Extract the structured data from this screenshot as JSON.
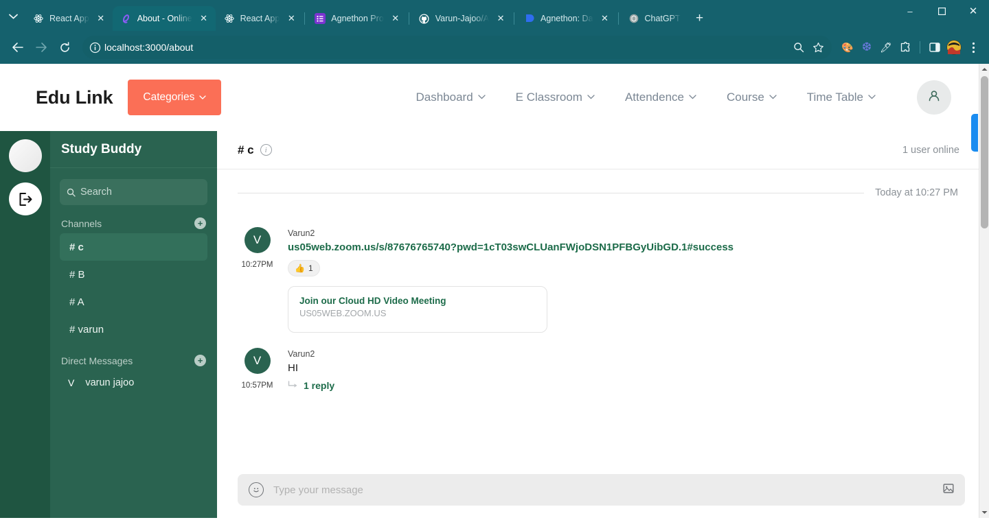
{
  "browser": {
    "tab_list_icon": "chevron-down-icon",
    "tabs": [
      {
        "title": "React App",
        "favicon": "react-icon",
        "active": false
      },
      {
        "title": "About - Online",
        "favicon": "swirl-icon",
        "active": true
      },
      {
        "title": "React App",
        "favicon": "react-icon",
        "active": false
      },
      {
        "title": "Agnethon Pro",
        "favicon": "list-icon",
        "active": false
      },
      {
        "title": "Varun-Jajoo/A",
        "favicon": "github-icon",
        "active": false
      },
      {
        "title": "Agnethon: Da",
        "favicon": "blue-doc-icon",
        "active": false
      },
      {
        "title": "ChatGPT",
        "favicon": "chatgpt-icon",
        "active": false
      }
    ],
    "new_tab_label": "+",
    "window_controls": {
      "minimize": "–",
      "maximize": "☐",
      "close": "✕"
    },
    "toolbar": {
      "back_label": "←",
      "forward_label": "→",
      "reload_label": "↻",
      "site_info_icon": "info-circle-icon",
      "url": "localhost:3000/about",
      "url_host": "localhost",
      "url_path": ":3000/about",
      "search_icon": "search-icon",
      "bookmark_icon": "star-icon",
      "extensions": [
        {
          "name": "color-palette-extension",
          "glyph": "🎨"
        },
        {
          "name": "snowflake-extension",
          "glyph": "❆"
        },
        {
          "name": "eyedropper-extension",
          "glyph": "🖊"
        },
        {
          "name": "puzzle-extensions",
          "glyph": "⬚"
        }
      ],
      "side_panel_icon": "side-panel-icon",
      "profile_icon": "profile-avatar-icon",
      "menu_icon": "three-dot-menu-icon"
    }
  },
  "site_header": {
    "brand": "Edu Link",
    "categories_label": "Categories",
    "caret": "˅",
    "nav": [
      {
        "label": "Dashboard"
      },
      {
        "label": "E Classroom"
      },
      {
        "label": "Attendence"
      },
      {
        "label": "Course"
      },
      {
        "label": "Time Table"
      }
    ],
    "profile_icon": "person-icon"
  },
  "rail": {
    "workspace_icon": "workspace-avatar",
    "logout_icon": "logout-icon"
  },
  "sidebar": {
    "title": "Study Buddy",
    "search": {
      "icon": "search-icon",
      "placeholder": "Search",
      "value": ""
    },
    "channels_section": {
      "label": "Channels",
      "add_label": "+"
    },
    "channels": [
      {
        "label": "# c",
        "active": true
      },
      {
        "label": "# B",
        "active": false
      },
      {
        "label": "# A",
        "active": false
      },
      {
        "label": "# varun",
        "active": false
      }
    ],
    "dm_section": {
      "label": "Direct Messages",
      "add_label": "+"
    },
    "direct_messages": [
      {
        "initial": "V",
        "name": "varun jajoo"
      }
    ]
  },
  "chat": {
    "channel": "# c",
    "info_icon": "info-circle-icon",
    "users_online": "1 user online",
    "date_divider": "Today at 10:27 PM",
    "messages": [
      {
        "author": "Varun2",
        "avatar_initial": "V",
        "time": "10:27PM",
        "text": "us05web.zoom.us/s/87676765740?pwd=1cT03swCLUanFWjoDSN1PFBGyUibGD.1#success",
        "is_link": true,
        "reaction": {
          "emoji": "👍",
          "count": "1"
        },
        "link_card": {
          "title": "Join our Cloud HD Video Meeting",
          "host": "US05WEB.ZOOM.US"
        }
      },
      {
        "author": "Varun2",
        "avatar_initial": "V",
        "time": "10:57PM",
        "text": "HI",
        "is_link": false,
        "thread": {
          "label": "1 reply",
          "arrow_icon": "reply-arrow-icon"
        }
      }
    ],
    "composer": {
      "emoji_icon": "emoji-smiley-icon",
      "placeholder": "Type your message",
      "value": "",
      "attach_icon": "image-attach-icon"
    }
  },
  "colors": {
    "browser_chrome": "#15616d",
    "brand_accent": "#fb6f56",
    "sidebar_green": "#2a6350",
    "rail_green": "#1f5541",
    "link_green": "#1c6b49",
    "side_tab_blue": "#1a8cf0"
  }
}
